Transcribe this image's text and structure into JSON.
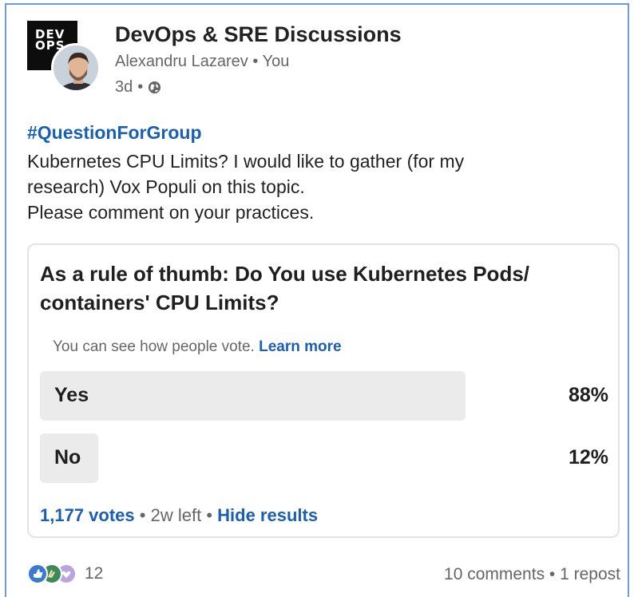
{
  "header": {
    "group_logo_text": "DEV OPS",
    "group_name": "DevOps & SRE Discussions",
    "author": "Alexandru Lazarev",
    "author_relation": "You",
    "time_ago": "3d",
    "visibility_icon": "globe-icon"
  },
  "post": {
    "hashtag": "#QuestionForGroup",
    "lines": [
      "Kubernetes CPU Limits? I would like to gather (for my",
      "research) Vox Populi on this topic.",
      "Please comment on your practices."
    ]
  },
  "poll": {
    "question": "As a rule of thumb: Do You use Kubernetes Pods/ containers' CPU Limits?",
    "note": "You can see how people vote.",
    "learn_more": "Learn more",
    "options": [
      {
        "label": "Yes",
        "percent_text": "88%",
        "percent": 88
      },
      {
        "label": "No",
        "percent_text": "12%",
        "percent": 12
      }
    ],
    "votes": "1,177 votes",
    "time_left": "2w left",
    "hide_results": "Hide results"
  },
  "social": {
    "reaction_icons": [
      "like-icon",
      "celebrate-icon",
      "support-icon"
    ],
    "reaction_count": "12",
    "comments": "10 comments",
    "reposts": "1 repost"
  },
  "colors": {
    "link_blue": "#1a5fb4",
    "bar_gray": "#ebebeb",
    "frame_border": "#6f9bd8"
  }
}
